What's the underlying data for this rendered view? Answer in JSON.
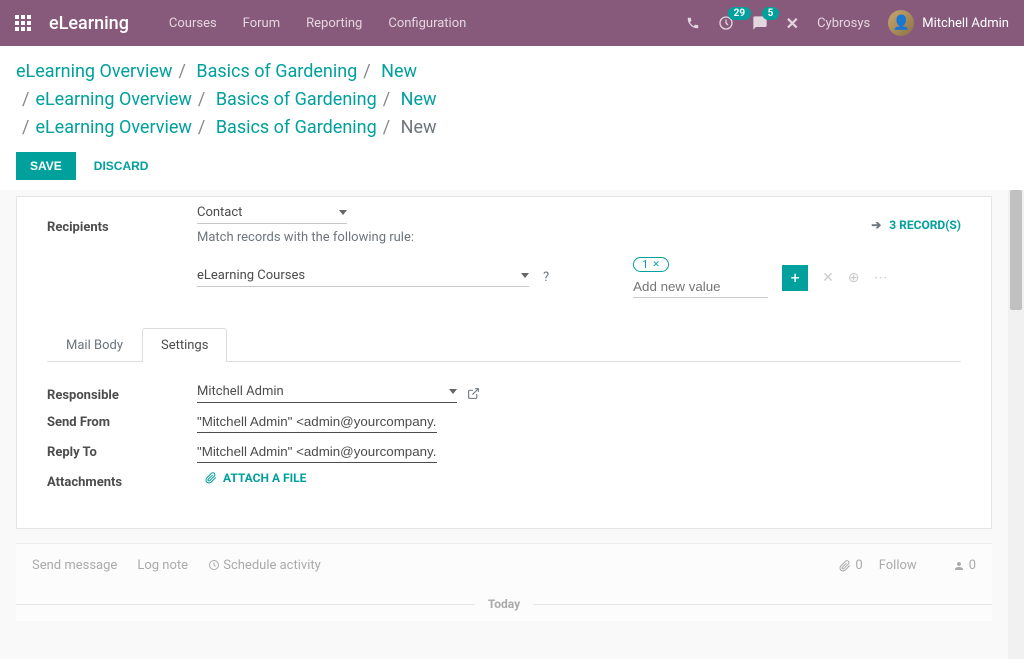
{
  "nav": {
    "brand": "eLearning",
    "links": [
      "Courses",
      "Forum",
      "Reporting",
      "Configuration"
    ],
    "badge_clock": "29",
    "badge_chat": "5",
    "company": "Cybrosys",
    "user": "Mitchell Admin"
  },
  "breadcrumbs": [
    [
      "eLearning Overview",
      "Basics of Gardening",
      "New"
    ],
    [
      "eLearning Overview",
      "Basics of Gardening",
      "New"
    ],
    [
      "eLearning Overview",
      "Basics of Gardening",
      "New"
    ]
  ],
  "actions": {
    "save": "SAVE",
    "discard": "DISCARD"
  },
  "form": {
    "recipients_label": "Recipients",
    "recipients_value": "Contact",
    "match_hint": "Match records with the following rule:",
    "records_link": "3 RECORD(S)",
    "filter_value": "eLearning Courses",
    "filter_q": "?",
    "tag_value": "1",
    "add_placeholder": "Add new value"
  },
  "tabs": {
    "mail_body": "Mail Body",
    "settings": "Settings"
  },
  "settings": {
    "responsible_label": "Responsible",
    "responsible_value": "Mitchell Admin",
    "send_from_label": "Send From",
    "send_from_value": "\"Mitchell Admin\" <admin@yourcompany.exa",
    "reply_to_label": "Reply To",
    "reply_to_value": "\"Mitchell Admin\" <admin@yourcompany.exa",
    "attachments_label": "Attachments",
    "attach_action": "ATTACH A FILE"
  },
  "chatter": {
    "send_message": "Send message",
    "log_note": "Log note",
    "schedule": "Schedule activity",
    "attach_count": "0",
    "follow": "Follow",
    "follower_count": "0",
    "today": "Today"
  }
}
